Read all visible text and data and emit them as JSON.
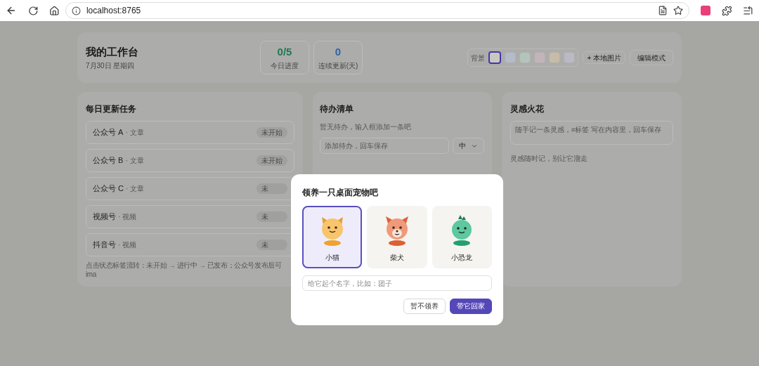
{
  "browser": {
    "url": "localhost:8765"
  },
  "header": {
    "title": "我的工作台",
    "date": "7月30日 星期四",
    "stats": [
      {
        "value": "0/5",
        "label": "今日进度",
        "color": "#1f7a52"
      },
      {
        "value": "0",
        "label": "连续更新(天)",
        "color": "#2e64a8"
      }
    ],
    "background": {
      "label": "背景",
      "swatches": [
        {
          "color": "#c9c7c1",
          "selected": true
        },
        {
          "color": "#b4bccb",
          "selected": false
        },
        {
          "color": "#b3c4bb",
          "selected": false
        },
        {
          "color": "#c3b4ba",
          "selected": false
        },
        {
          "color": "#c7bca6",
          "selected": false
        },
        {
          "color": "#bab9c5",
          "selected": false
        }
      ]
    },
    "buttons": [
      "+ 本地图片",
      "编辑模式"
    ]
  },
  "tasks": {
    "title": "每日更新任务",
    "rows": [
      {
        "name": "公众号 A",
        "type": "· 文章",
        "status": "未开始"
      },
      {
        "name": "公众号 B",
        "type": "· 文章",
        "status": "未开始"
      },
      {
        "name": "公众号 C",
        "type": "· 文章",
        "status": "未"
      },
      {
        "name": "视频号",
        "type": "· 视频",
        "status": "未"
      },
      {
        "name": "抖音号",
        "type": "· 视频",
        "status": "未"
      }
    ],
    "hint_lines": [
      "点击状态标签流转：未开始 → 进行中 → 已发布；公众号发布后可",
      "ima"
    ]
  },
  "todo": {
    "title": "待办清单",
    "empty": "暂无待办，输入框添加一条吧",
    "placeholder": "添加待办，回车保存",
    "priority": "中"
  },
  "ideas": {
    "title": "灵感火花",
    "placeholder": "随手记一条灵感，#标签 写在内容里，回车保存",
    "empty": "灵感随时记，别让它溜走"
  },
  "modal": {
    "title": "领养一只桌面宠物吧",
    "pets": [
      {
        "name": "小猫",
        "kind": "cat",
        "selected": true
      },
      {
        "name": "柴犬",
        "kind": "dog",
        "selected": false
      },
      {
        "name": "小恐龙",
        "kind": "dino",
        "selected": false
      }
    ],
    "name_placeholder": "给它起个名字，比如：团子",
    "buttons": [
      {
        "label": "暂不领养",
        "kind": "secondary"
      },
      {
        "label": "带它回家",
        "kind": "primary"
      }
    ]
  }
}
